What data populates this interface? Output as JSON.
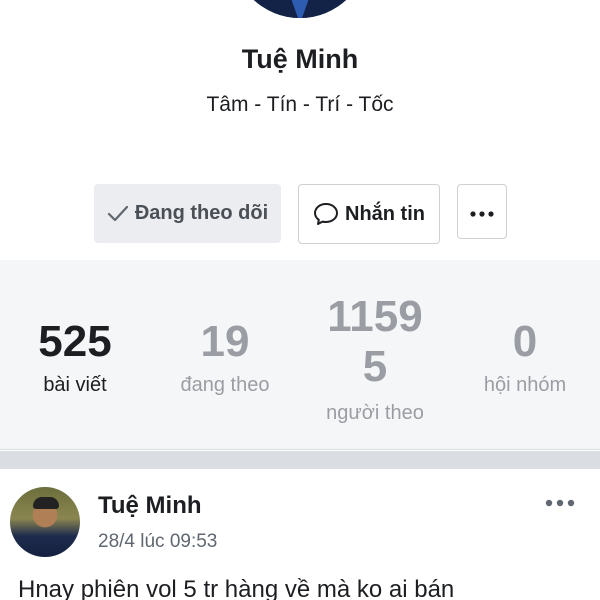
{
  "profile": {
    "name": "Tuệ Minh",
    "bio": "Tâm - Tín - Trí - Tốc"
  },
  "actions": {
    "following_label": "Đang theo dõi",
    "message_label": "Nhắn tin"
  },
  "stats": {
    "posts": {
      "value": "525",
      "label": "bài viết"
    },
    "following": {
      "value": "19",
      "label": "đang theo"
    },
    "followers": {
      "value_line1": "1159",
      "value_line2": "5",
      "label": "người theo"
    },
    "groups": {
      "value": "0",
      "label": "hội nhóm"
    }
  },
  "post": {
    "author": "Tuệ Minh",
    "timestamp": "28/4 lúc 09:53",
    "text": "Hnay phiên vol 5 tr hàng về mà ko ai bán"
  },
  "icons": {
    "following": "check-icon",
    "message": "message-bubble-icon",
    "more": "more-horizontal-icon"
  }
}
